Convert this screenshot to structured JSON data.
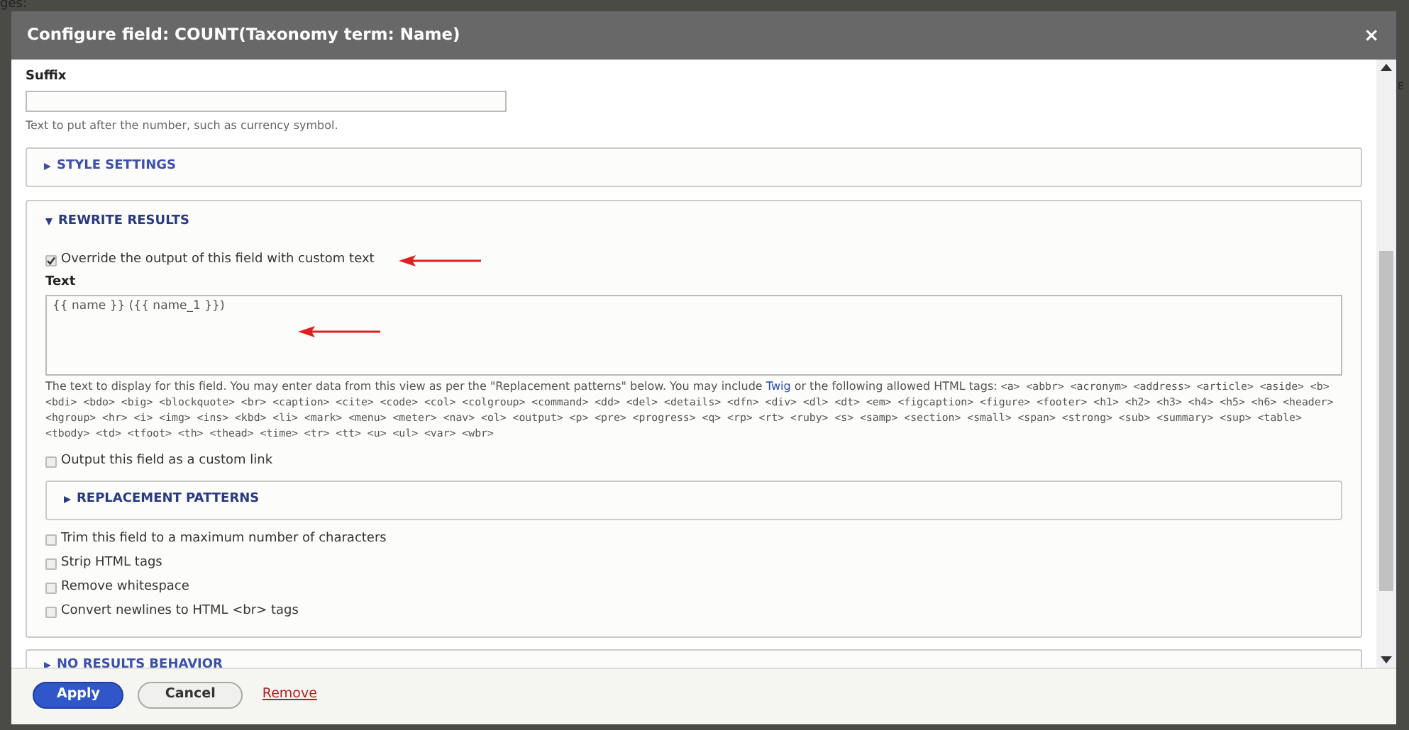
{
  "background": {
    "fragments": [
      "ges:",
      "E"
    ]
  },
  "dialog": {
    "title": "Configure field: COUNT(Taxonomy term: Name)",
    "close": "×"
  },
  "suffix": {
    "label": "Suffix",
    "help": "Text to put after the number, such as currency symbol."
  },
  "sections": [
    {
      "title": "STYLE SETTINGS",
      "expanded": false
    },
    {
      "title": "REWRITE RESULTS",
      "expanded": true
    },
    {
      "title": "NO RESULTS BEHAVIOR",
      "expanded": false
    }
  ],
  "rewrite": {
    "override": {
      "label": "Override the output of this field with custom text",
      "checked": true
    },
    "text_label": "Text",
    "text_value": "{{ name }} ({{ name_1 }})",
    "description": "The text to display for this field. You may enter data from this view as per the \"Replacement patterns\" below. You may include",
    "description_link": "Twig",
    "description_after": "or the following allowed HTML tags:",
    "allowed_tags": "<a> <abbr> <acronym> <address> <article> <aside> <b> <bdi> <bdo> <big> <blockquote> <br> <caption> <cite> <code> <col> <colgroup> <command> <dd> <del> <details> <dfn> <div> <dl> <dt> <em> <figcaption> <figure> <footer> <h1> <h2> <h3> <h4> <h5> <h6> <header> <hgroup> <hr> <i> <img> <ins> <kbd> <li> <mark> <menu> <meter> <nav> <ol> <output> <p> <pre> <progress> <q> <rp> <rt> <ruby> <s> <samp> <section> <small> <span> <strong> <sub> <summary> <sup> <table> <tbody> <td> <tfoot> <th> <thead> <time> <tr> <tt> <u> <ul> <var> <wbr>",
    "custom_link": {
      "label": "Output this field as a custom link",
      "checked": false
    },
    "replacement": {
      "title": "REPLACEMENT PATTERNS",
      "expanded": false
    },
    "options": [
      {
        "label": "Trim this field to a maximum number of characters",
        "checked": false
      },
      {
        "label": "Strip HTML tags",
        "checked": false
      },
      {
        "label": "Remove whitespace",
        "checked": false
      },
      {
        "label": "Convert newlines to HTML <br> tags",
        "checked": false
      }
    ]
  },
  "buttons": [
    {
      "label": "Apply",
      "kind": "primary"
    },
    {
      "label": "Cancel",
      "kind": "secondary"
    },
    {
      "label": "Remove",
      "kind": "link"
    }
  ]
}
